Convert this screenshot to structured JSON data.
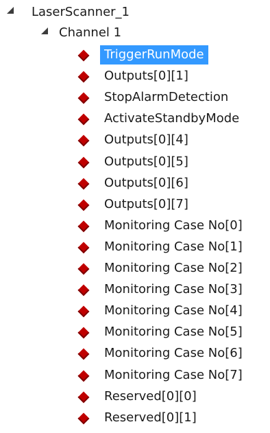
{
  "root": {
    "label": "LaserScanner_1",
    "expanded_icon": "expanded-triangle-icon"
  },
  "channel": {
    "label": "Channel 1",
    "expanded_icon": "expanded-triangle-icon"
  },
  "leaf_icon": "red-diamond-icon",
  "colors": {
    "selection": "#3399ff",
    "diamond": "#c00000"
  },
  "items": [
    {
      "label": "TriggerRunMode",
      "selected": true
    },
    {
      "label": "Outputs[0][1]"
    },
    {
      "label": "StopAlarmDetection"
    },
    {
      "label": "ActivateStandbyMode"
    },
    {
      "label": "Outputs[0][4]"
    },
    {
      "label": "Outputs[0][5]"
    },
    {
      "label": "Outputs[0][6]"
    },
    {
      "label": "Outputs[0][7]"
    },
    {
      "label": "Monitoring Case No[0]"
    },
    {
      "label": "Monitoring Case No[1]"
    },
    {
      "label": "Monitoring Case No[2]"
    },
    {
      "label": "Monitoring Case No[3]"
    },
    {
      "label": "Monitoring Case No[4]"
    },
    {
      "label": "Monitoring Case No[5]"
    },
    {
      "label": "Monitoring Case No[6]"
    },
    {
      "label": "Monitoring Case No[7]"
    },
    {
      "label": "Reserved[0][0]"
    },
    {
      "label": "Reserved[0][1]"
    }
  ]
}
